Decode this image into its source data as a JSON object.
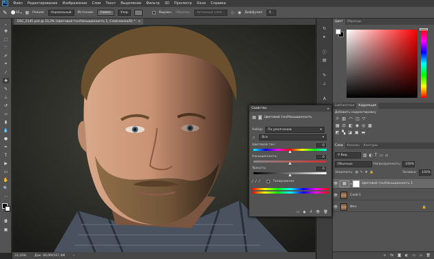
{
  "menubar": {
    "app": "Ps",
    "items": [
      "Файл",
      "Редактирование",
      "Изображение",
      "Слои",
      "Текст",
      "Выделение",
      "Фильтр",
      "3D",
      "Просмотр",
      "Окно",
      "Справка"
    ]
  },
  "options": {
    "brush_size": "30",
    "mode_label": "Режим:",
    "mode_value": "Нормальный",
    "source_label": "Источник:",
    "source_sample": "Семпл.",
    "source_pattern": "Узор",
    "aligned_label": "Выравн.",
    "sample_label": "Образец:",
    "sample_value": "Активный слой",
    "diffusion_label": "Диффузия:",
    "diffusion_value": "5"
  },
  "document_tab": "DSC_2145.psd @ 33,3% (Цветовой тон/Насыщенность 1, Слой-маска/8) *",
  "status": {
    "zoom": "33,33%",
    "doc": "Док: 46,0M/107,4M"
  },
  "color_panel": {
    "tabs": [
      "Цвет",
      "Образцы"
    ]
  },
  "adjust_panel": {
    "tabs": [
      "Библиотеки",
      "Коррекция"
    ],
    "title": "Добавить корректировку"
  },
  "properties": {
    "title": "Свойства",
    "adj_name": "Цветовой тон/Насыщенность",
    "preset_label": "Набор:",
    "preset_value": "По умолчанию",
    "channel_value": "Все",
    "hue_label": "Цветовой тон:",
    "hue_value": "0",
    "sat_label": "Насыщенность:",
    "sat_value": "0",
    "light_label": "Яркость:",
    "light_value": "0",
    "colorize_label": "Тонирование",
    "hue_pos": 0.5,
    "sat_pos": 0.5,
    "light_pos": 0.5
  },
  "layers_panel": {
    "tabs": [
      "Слои",
      "Каналы",
      "Контуры"
    ],
    "kind_value": "Вид",
    "blend_value": "Обычные",
    "opacity_label": "Непрозрачность:",
    "opacity_value": "100%",
    "lock_label": "Закрепить:",
    "fill_label": "Заливка:",
    "fill_value": "100%",
    "layers": [
      {
        "name": "Цветовой тон/Насыщенность 1"
      },
      {
        "name": "Слой 1"
      },
      {
        "name": "Фон"
      }
    ]
  },
  "colors": {
    "accent": "#31a8ff",
    "panel": "#535353"
  }
}
